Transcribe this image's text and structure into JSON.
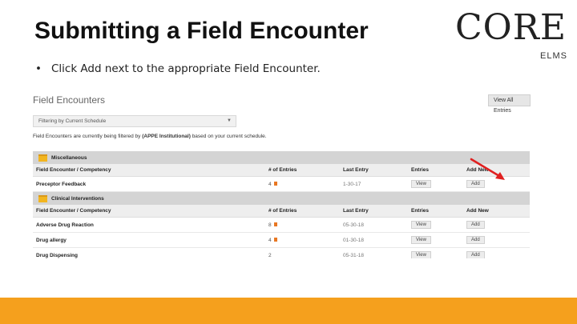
{
  "slide": {
    "title": "Submitting a Field Encounter",
    "bullet_symbol": "•",
    "bullet_text": "Click Add next to the appropriate Field Encounter.",
    "logo_main": "CORE",
    "logo_sub": "ELMS",
    "bottom_bar_color": "#f5a01d"
  },
  "screenshot": {
    "page_title": "Field Encounters",
    "view_all_label": "View All Entries",
    "filter_select_value": "Filtering by Current Schedule",
    "filter_note_prefix": "Field Encounters are currently being filtered by ",
    "filter_note_bold": "(APPE Institutional)",
    "filter_note_suffix": " based on your current schedule.",
    "columns": [
      "Field Encounter / Competency",
      "# of Entries",
      "Last Entry",
      "Entries",
      "Add New"
    ],
    "groups": [
      {
        "name": "Miscellaneous",
        "rows": [
          {
            "name": "Preceptor Feedback",
            "count": "4",
            "flag": true,
            "last_entry": "1-30-17",
            "view_label": "View",
            "add_label": "Add"
          }
        ]
      },
      {
        "name": "Clinical Interventions",
        "rows": [
          {
            "name": "Adverse Drug Reaction",
            "count": "8",
            "flag": true,
            "last_entry": "05-30-18",
            "view_label": "View",
            "add_label": "Add"
          },
          {
            "name": "Drug allergy",
            "count": "4",
            "flag": true,
            "last_entry": "01-30-18",
            "view_label": "View",
            "add_label": "Add"
          },
          {
            "name": "Drug Dispensing",
            "count": "2",
            "flag": false,
            "last_entry": "05-31-18",
            "view_label": "View",
            "add_label": "Add"
          }
        ]
      }
    ],
    "icons": {
      "group": "folder-icon",
      "flag": "flag-icon",
      "dropdown": "caret-down-icon",
      "annotation": "red-arrow-icon"
    },
    "colors": {
      "folder": "#f2b51f",
      "flag": "#e87722",
      "arrow": "#e02020"
    }
  }
}
